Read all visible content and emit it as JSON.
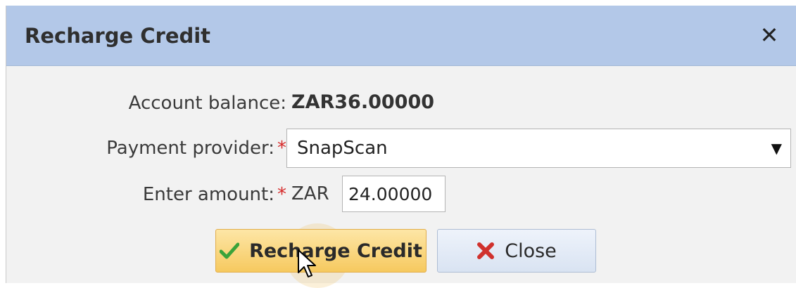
{
  "dialog": {
    "title": "Recharge Credit",
    "close_glyph": "✕"
  },
  "form": {
    "balance_label": "Account balance:",
    "balance_value": "ZAR36.00000",
    "provider_label": "Payment provider:",
    "provider_value": "SnapScan",
    "amount_label": "Enter amount:",
    "amount_currency": "ZAR",
    "amount_value": "24.00000",
    "required_mark": "*"
  },
  "buttons": {
    "recharge_label": "Recharge Credit",
    "close_label": "Close"
  },
  "icons": {
    "recharge": "check-icon",
    "close": "red-x-icon",
    "dropdown": "triangle-down-icon",
    "cursor": "mouse-pointer-icon"
  },
  "colors": {
    "titlebar": "#b3c8e8",
    "required": "#d62a2a",
    "primary_button": "#f6c95f",
    "secondary_button": "#d9e3f2"
  }
}
